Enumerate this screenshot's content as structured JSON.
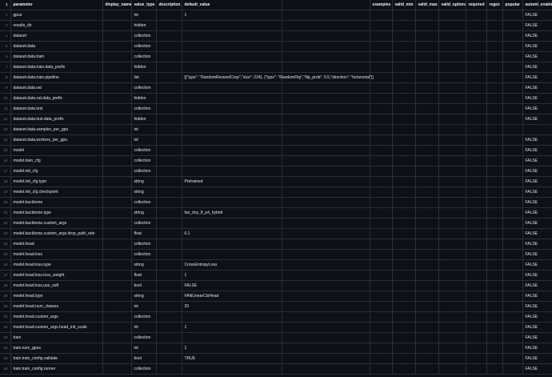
{
  "headers": [
    "parameter",
    "display_name",
    "value_type",
    "description",
    "default_value",
    "",
    "examples",
    "valid_min",
    "valid_max",
    "valid_options",
    "required",
    "regex",
    "popular",
    "automl_enabled"
  ],
  "rows": [
    {
      "n": "2",
      "parameter": "gpus",
      "value_type": "int",
      "default_value": "1",
      "automl": "FALSE"
    },
    {
      "n": "3",
      "parameter": "results_dir",
      "value_type": "hidden",
      "default_value": "",
      "automl": "FALSE"
    },
    {
      "n": "4",
      "parameter": "dataset",
      "value_type": "collection",
      "default_value": "",
      "automl": "FALSE"
    },
    {
      "n": "5",
      "parameter": "dataset.data",
      "value_type": "collection",
      "default_value": "",
      "automl": "FALSE"
    },
    {
      "n": "6",
      "parameter": "dataset.data.train",
      "value_type": "collection",
      "default_value": "",
      "automl": "FALSE"
    },
    {
      "n": "7",
      "parameter": "dataset.data.train.data_prefix",
      "value_type": "hidden",
      "default_value": "",
      "automl": "FALSE"
    },
    {
      "n": "8",
      "parameter": "dataset.data.train.pipeline",
      "value_type": "list",
      "default_value": "[{\"type\": \"RandomResizedCrop\",\"size\": 224}, {\"type\": \"RandomFlip\",\"flip_prob\": 0.5,\"direction\": \"horizontal\"}]",
      "automl": "FALSE"
    },
    {
      "n": "9",
      "parameter": "dataset.data.val",
      "value_type": "collection",
      "default_value": "",
      "automl": "FALSE"
    },
    {
      "n": "10",
      "parameter": "dataset.data.val.data_prefix",
      "value_type": "hidden",
      "default_value": "",
      "automl": "FALSE"
    },
    {
      "n": "11",
      "parameter": "dataset.data.test",
      "value_type": "collection",
      "default_value": "",
      "automl": "FALSE"
    },
    {
      "n": "12",
      "parameter": "dataset.data.test.data_prefix",
      "value_type": "hidden",
      "default_value": "",
      "automl": "FALSE"
    },
    {
      "n": "13",
      "parameter": "dataset.data.samples_per_gpu",
      "value_type": "int",
      "default_value": "",
      "automl": ""
    },
    {
      "n": "14",
      "parameter": "dataset.data.workers_per_gpu",
      "value_type": "int",
      "default_value": "",
      "automl": "FALSE"
    },
    {
      "n": "15",
      "parameter": "model",
      "value_type": "collection",
      "default_value": "",
      "automl": "FALSE"
    },
    {
      "n": "16",
      "parameter": "model.train_cfg",
      "value_type": "collection",
      "default_value": "",
      "automl": "FALSE"
    },
    {
      "n": "17",
      "parameter": "model.init_cfg",
      "value_type": "collection",
      "default_value": "",
      "automl": "FALSE"
    },
    {
      "n": "18",
      "parameter": "model.init_cfg.type",
      "value_type": "string",
      "default_value": "Pretrained",
      "automl": "FALSE"
    },
    {
      "n": "19",
      "parameter": "model.init_cfg.checkpoint",
      "value_type": "string",
      "default_value": "",
      "automl": "FALSE"
    },
    {
      "n": "20",
      "parameter": "model.backbone",
      "value_type": "collection",
      "default_value": "",
      "automl": "FALSE"
    },
    {
      "n": "21",
      "parameter": "model.backbone.type",
      "value_type": "string",
      "default_value": "fan_tiny_8_p4_hybrid",
      "automl": "FALSE"
    },
    {
      "n": "22",
      "parameter": "model.backbone.custom_args",
      "value_type": "collection",
      "default_value": "",
      "automl": "FALSE"
    },
    {
      "n": "23",
      "parameter": "model.backbone.custom_args.drop_path_rate",
      "value_type": "float",
      "default_value": "0.1",
      "automl": "FALSE"
    },
    {
      "n": "24",
      "parameter": "model.head",
      "value_type": "collection",
      "default_value": "",
      "automl": "FALSE"
    },
    {
      "n": "25",
      "parameter": "model.head.loss",
      "value_type": "collection",
      "default_value": "",
      "automl": "FALSE"
    },
    {
      "n": "26",
      "parameter": "model.head.loss.type",
      "value_type": "string",
      "default_value": "CrossEntropyLoss",
      "automl": "FALSE"
    },
    {
      "n": "27",
      "parameter": "model.head.loss.loss_weight",
      "value_type": "float",
      "default_value": "1",
      "automl": "FALSE"
    },
    {
      "n": "28",
      "parameter": "model.head.loss.use_soft",
      "value_type": "bool",
      "default_value": "FALSE",
      "automl": "FALSE"
    },
    {
      "n": "29",
      "parameter": "model.head.type",
      "value_type": "string",
      "default_value": "FANLinearClsHead",
      "automl": "FALSE"
    },
    {
      "n": "30",
      "parameter": "model.head.num_classes",
      "value_type": "int",
      "default_value": "20",
      "automl": "FALSE"
    },
    {
      "n": "31",
      "parameter": "model.head.custom_args",
      "value_type": "collection",
      "default_value": "",
      "automl": "FALSE"
    },
    {
      "n": "32",
      "parameter": "model.head.custom_args.head_init_scale",
      "value_type": "int",
      "default_value": "1",
      "automl": "FALSE"
    },
    {
      "n": "33",
      "parameter": "train",
      "value_type": "collection",
      "default_value": "",
      "automl": "FALSE"
    },
    {
      "n": "34",
      "parameter": "train.num_gpus",
      "value_type": "int",
      "default_value": "1",
      "automl": "FALSE"
    },
    {
      "n": "35",
      "parameter": "train.train_config.validate",
      "value_type": "bool",
      "default_value": "TRUE",
      "automl": "FALSE"
    },
    {
      "n": "36",
      "parameter": "train.train_config.runner",
      "value_type": "collection",
      "default_value": "",
      "automl": "FALSE"
    }
  ]
}
